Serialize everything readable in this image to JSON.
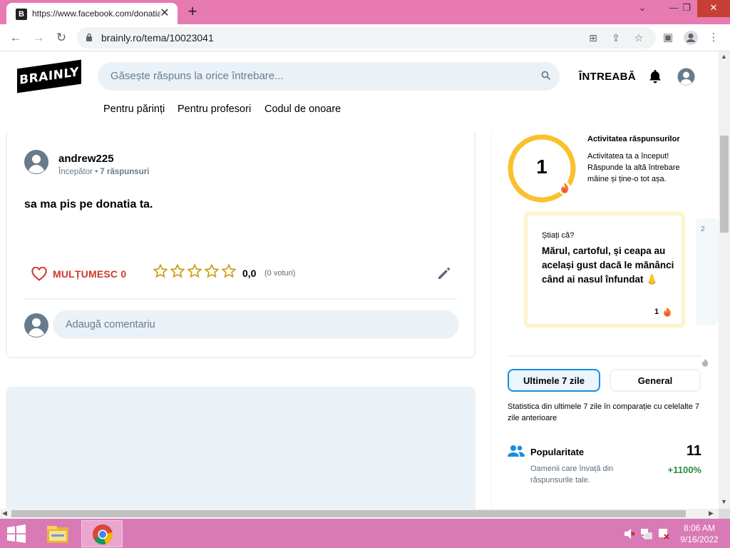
{
  "browser": {
    "tab_title": "https://www.facebook.com/donatia",
    "tab_favicon": "B",
    "url": "brainly.ro/tema/10023041"
  },
  "site": {
    "logo": "BRAINLY",
    "search_placeholder": "Găsește răspuns la orice întrebare...",
    "ask_label": "ÎNTREABĂ",
    "subnav": [
      "Pentru părinți",
      "Pentru profesori",
      "Codul de onoare"
    ]
  },
  "answer": {
    "username": "andrew225",
    "rank": "Începător",
    "answers_count": "7 răspunsuri",
    "text": "sa ma pis pe donatia ta.",
    "thanks_label": "MULȚUMESC 0",
    "stars_filled": 0,
    "rating": "0,0",
    "votes": "(0 voturi)",
    "comment_placeholder": "Adaugă comentariu"
  },
  "sidebar": {
    "streak_number": "1",
    "activity_title": "Activitatea răspunsurilor",
    "activity_desc": "Activitatea ta a început! Răspunde la altă întrebare mâine și ține-o tot așa.",
    "fact_question": "Știați că?",
    "fact_text": "Mărul, cartoful, și ceapa au același gust dacă le mănânci când ai nasul înfundat 👃",
    "fact_count": "1",
    "next_fact_number": "2",
    "tab_week": "Ultimele 7 zile",
    "tab_general": "General",
    "stats_desc": "Statistica din ultimele 7 zile în comparație cu celelalte 7 zile anterioare",
    "popularity_title": "Popularitate",
    "popularity_desc": "Oamenii care învață din răspunsurile tale.",
    "popularity_value": "11",
    "popularity_change": "+1100%"
  },
  "taskbar": {
    "time": "8:06 AM",
    "date": "9/16/2022"
  },
  "colors": {
    "chrome_frame": "#e77ab0",
    "taskbar": "#d97ab6",
    "accent_red": "#d0372d",
    "accent_blue": "#1a8ddb",
    "streak_yellow": "#fbc02d",
    "positive_green": "#2c8a3c"
  }
}
